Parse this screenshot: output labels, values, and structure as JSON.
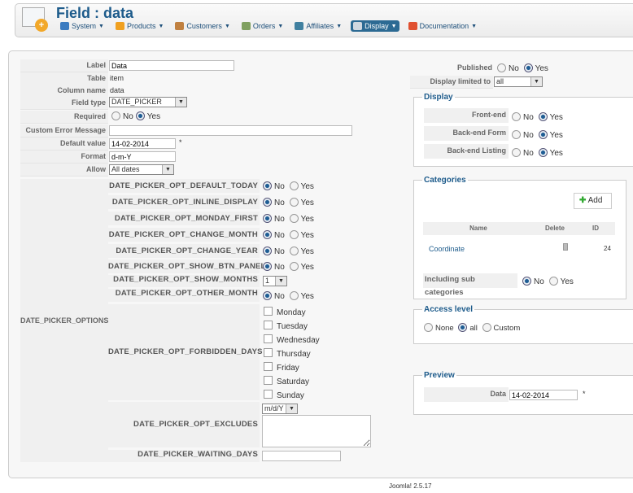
{
  "header": {
    "title": "Field : data",
    "menu": [
      {
        "label": "System",
        "color": "#3b7bc0"
      },
      {
        "label": "Products",
        "color": "#f0a020"
      },
      {
        "label": "Customers",
        "color": "#c08040"
      },
      {
        "label": "Orders",
        "color": "#80a060"
      },
      {
        "label": "Affiliates",
        "color": "#4080a0"
      },
      {
        "label": "Display",
        "color": "#d0d8e0"
      },
      {
        "label": "Documentation",
        "color": "#e05030"
      }
    ]
  },
  "form": {
    "label_label": "Label",
    "label_value": "Data",
    "table_label": "Table",
    "table_value": "item",
    "column_label": "Column name",
    "column_value": "data",
    "fieldtype_label": "Field type",
    "fieldtype_value": "DATE_PICKER",
    "required_label": "Required",
    "no": "No",
    "yes": "Yes",
    "custom_error_label": "Custom Error Message",
    "custom_error_value": "",
    "default_label": "Default value",
    "default_value": "14-02-2014",
    "asterisk": "*",
    "format_label": "Format",
    "format_value": "d-m-Y",
    "allow_label": "Allow",
    "allow_value": "All dates"
  },
  "options": {
    "group_label": "DATE_PICKER_OPTIONS",
    "radios": [
      {
        "label": "DATE_PICKER_OPT_DEFAULT_TODAY",
        "value": "No"
      },
      {
        "label": "DATE_PICKER_OPT_INLINE_DISPLAY",
        "value": "No"
      },
      {
        "label": "DATE_PICKER_OPT_MONDAY_FIRST",
        "value": "No"
      },
      {
        "label": "DATE_PICKER_OPT_CHANGE_MONTH",
        "value": "No"
      },
      {
        "label": "DATE_PICKER_OPT_CHANGE_YEAR",
        "value": "No"
      },
      {
        "label": "DATE_PICKER_OPT_SHOW_BTN_PANEL",
        "value": "No"
      }
    ],
    "show_months_label": "DATE_PICKER_OPT_SHOW_MONTHS",
    "show_months_value": "1",
    "other_month_label": "DATE_PICKER_OPT_OTHER_MONTH",
    "forbidden_label": "DATE_PICKER_OPT_FORBIDDEN_DAYS",
    "days": [
      "Monday",
      "Tuesday",
      "Wednesday",
      "Thursday",
      "Friday",
      "Saturday",
      "Sunday"
    ],
    "excludes_label": "DATE_PICKER_OPT_EXCLUDES",
    "excludes_format": "m/d/Y",
    "excludes_value": "",
    "waiting_label": "DATE_PICKER_WAITING_DAYS",
    "waiting_value": ""
  },
  "right": {
    "published_label": "Published",
    "display_limited_label": "Display limited to",
    "display_limited_value": "all",
    "display_legend": "Display",
    "frontend": "Front-end",
    "backend_form": "Back-end Form",
    "backend_listing": "Back-end Listing",
    "categories_legend": "Categories",
    "add": "Add",
    "col_name": "Name",
    "col_delete": "Delete",
    "col_id": "ID",
    "cat_name": "Coordinate",
    "cat_id": "24",
    "include_sub": "Including sub categories",
    "access_legend": "Access level",
    "access_none": "None",
    "access_all": "all",
    "access_custom": "Custom",
    "preview_legend": "Preview",
    "preview_label": "Data",
    "preview_value": "14-02-2014"
  },
  "footer": "Joomla! 2.5.17"
}
